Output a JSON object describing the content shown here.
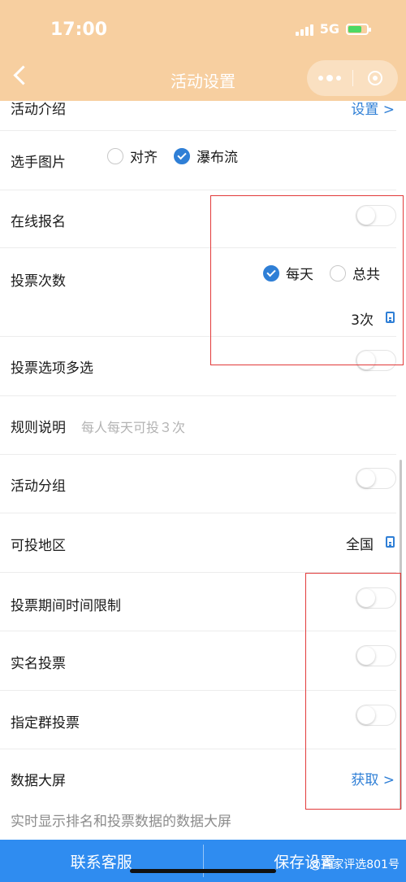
{
  "status_bar": {
    "time": "17:00",
    "network": "5G"
  },
  "nav": {
    "title": "活动设置"
  },
  "partial_top": {
    "label": "活动介绍",
    "action": "设置 >"
  },
  "photo_row": {
    "label": "选手图片",
    "options": [
      "对齐",
      "瀑布流"
    ],
    "selected": "瀑布流"
  },
  "online_signup": {
    "label": "在线报名"
  },
  "vote_count": {
    "label": "投票次数",
    "options": [
      "每天",
      "总共"
    ],
    "selected": "每天",
    "value": "3次"
  },
  "multi_select": {
    "label": "投票选项多选"
  },
  "rules": {
    "label": "规则说明",
    "text": "每人每天可投３次"
  },
  "grouping": {
    "label": "活动分组"
  },
  "region": {
    "label": "可投地区",
    "value": "全国"
  },
  "time_limit": {
    "label": "投票期间时间限制"
  },
  "real_name": {
    "label": "实名投票"
  },
  "group_vote": {
    "label": "指定群投票"
  },
  "data_screen": {
    "label": "数据大屏",
    "action": "获取 >",
    "desc": "实时显示排名和投票数据的数据大屏"
  },
  "bottom": {
    "contact": "联系客服",
    "save": "保存设置"
  },
  "watermark": "@吝家评选801号",
  "colors": {
    "header": "#f7cfa0",
    "accent": "#2f7fd6",
    "bottom_bar": "#2f8cf0",
    "annotation": "#e23a3a"
  }
}
